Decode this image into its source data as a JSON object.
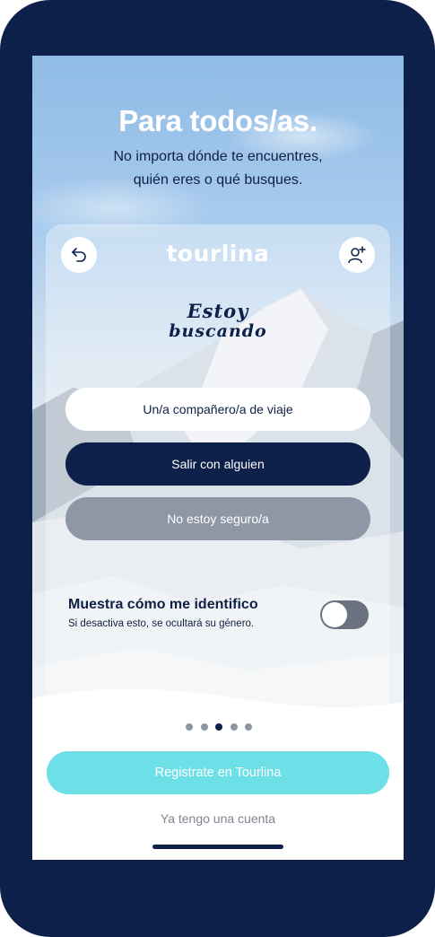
{
  "hero": {
    "title": "Para todos/as.",
    "subtitle_line1": "No importa dónde te encuentres,",
    "subtitle_line2": "quién eres o qué busques."
  },
  "card": {
    "back_icon": "undo-arrow-icon",
    "logo": "tourlina",
    "profile_icon": "add-user-icon",
    "heading_line1": "Estoy",
    "heading_line2": "buscando",
    "options": [
      {
        "label": "Un/a compañero/a de viaje"
      },
      {
        "label": "Salir con alguien"
      },
      {
        "label": "No estoy seguro/a"
      }
    ],
    "selected_option": "Salir con alguien",
    "toggle": {
      "title": "Muestra cómo me identifico",
      "subtitle": "Si desactiva esto, se ocultará su género.",
      "on": false
    }
  },
  "pagination": {
    "count": 5,
    "active": 3
  },
  "register_label": "Registrate en Tourlina",
  "login_label": "Ya tengo una cuenta",
  "colors": {
    "navy": "#0c2049",
    "accent": "#6ddfe6",
    "muted": "#8e97a5"
  }
}
